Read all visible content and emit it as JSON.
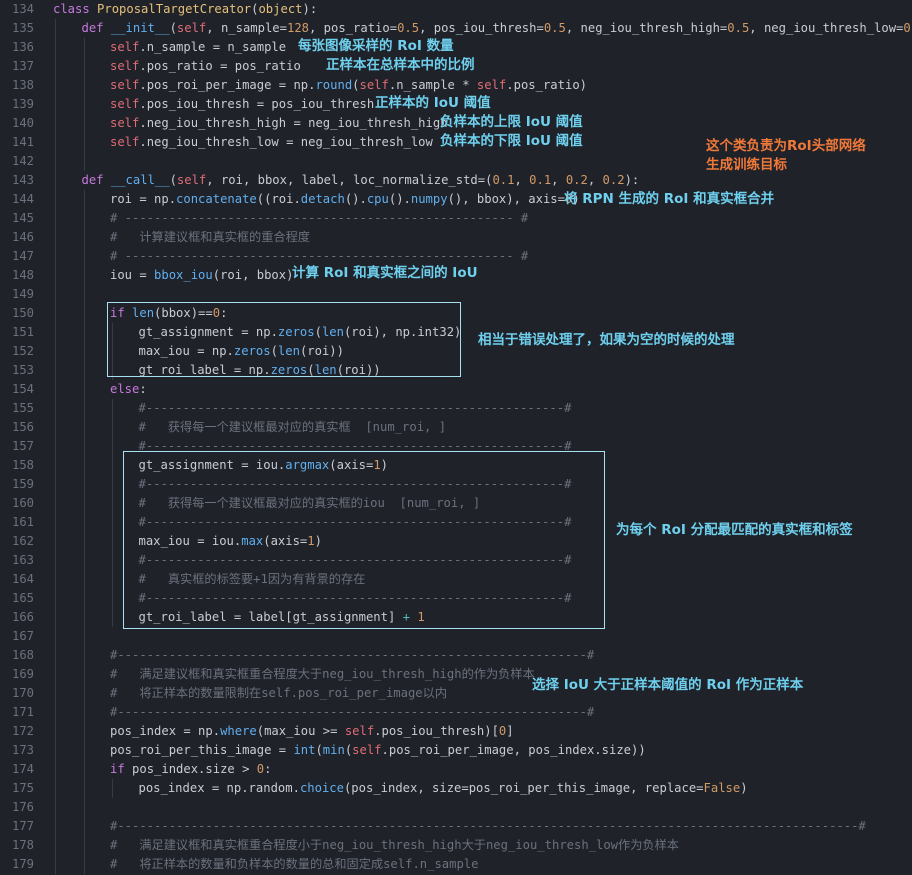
{
  "editor": {
    "lines": [
      {
        "n": "134",
        "indent": 0,
        "tokens": [
          [
            "kw",
            "class "
          ],
          [
            "cls",
            "ProposalTargetCreator"
          ],
          [
            "",
            "("
          ],
          [
            "cls",
            "object"
          ],
          [
            "",
            "):"
          ]
        ]
      },
      {
        "n": "135",
        "indent": 1,
        "tokens": [
          [
            "kw",
            "def "
          ],
          [
            "fn",
            "__init__"
          ],
          [
            "",
            "("
          ],
          [
            "self",
            "self"
          ],
          [
            "",
            ", n_sample="
          ],
          [
            "num",
            "128"
          ],
          [
            "",
            ", pos_ratio="
          ],
          [
            "num",
            "0.5"
          ],
          [
            "",
            ", pos_iou_thresh="
          ],
          [
            "num",
            "0.5"
          ],
          [
            "",
            ", neg_iou_thresh_high="
          ],
          [
            "num",
            "0.5"
          ],
          [
            "",
            ", neg_iou_thresh_low="
          ],
          [
            "num",
            "0"
          ],
          [
            "",
            "):"
          ]
        ]
      },
      {
        "n": "136",
        "indent": 2,
        "tokens": [
          [
            "self",
            "self"
          ],
          [
            "",
            ".n_sample = n_sample"
          ]
        ]
      },
      {
        "n": "137",
        "indent": 2,
        "tokens": [
          [
            "self",
            "self"
          ],
          [
            "",
            ".pos_ratio = pos_ratio"
          ]
        ]
      },
      {
        "n": "138",
        "indent": 2,
        "tokens": [
          [
            "self",
            "self"
          ],
          [
            "",
            ".pos_roi_per_image = np."
          ],
          [
            "fn",
            "round"
          ],
          [
            "",
            "("
          ],
          [
            "self",
            "self"
          ],
          [
            "",
            ".n_sample * "
          ],
          [
            "self",
            "self"
          ],
          [
            "",
            ".pos_ratio)"
          ]
        ]
      },
      {
        "n": "139",
        "indent": 2,
        "tokens": [
          [
            "self",
            "self"
          ],
          [
            "",
            ".pos_iou_thresh = pos_iou_thresh"
          ]
        ]
      },
      {
        "n": "140",
        "indent": 2,
        "tokens": [
          [
            "self",
            "self"
          ],
          [
            "",
            ".neg_iou_thresh_high = neg_iou_thresh_high"
          ]
        ]
      },
      {
        "n": "141",
        "indent": 2,
        "tokens": [
          [
            "self",
            "self"
          ],
          [
            "",
            ".neg_iou_thresh_low = neg_iou_thresh_low"
          ]
        ]
      },
      {
        "n": "142",
        "indent": 2,
        "tokens": []
      },
      {
        "n": "143",
        "indent": 1,
        "tokens": [
          [
            "kw",
            "def "
          ],
          [
            "fn",
            "__call__"
          ],
          [
            "",
            "("
          ],
          [
            "self",
            "self"
          ],
          [
            "",
            ", roi, bbox, label, loc_normalize_std=("
          ],
          [
            "num",
            "0.1"
          ],
          [
            "",
            ", "
          ],
          [
            "num",
            "0.1"
          ],
          [
            "",
            ", "
          ],
          [
            "num",
            "0.2"
          ],
          [
            "",
            ", "
          ],
          [
            "num",
            "0.2"
          ],
          [
            "",
            "):"
          ]
        ]
      },
      {
        "n": "144",
        "indent": 2,
        "tokens": [
          [
            "",
            "roi = np."
          ],
          [
            "fn",
            "concatenate"
          ],
          [
            "",
            "((roi."
          ],
          [
            "fn",
            "detach"
          ],
          [
            "",
            "()."
          ],
          [
            "fn",
            "cpu"
          ],
          [
            "",
            "()."
          ],
          [
            "fn",
            "numpy"
          ],
          [
            "",
            "(), bbox), axis="
          ],
          [
            "num",
            "0"
          ],
          [
            "",
            ")"
          ]
        ]
      },
      {
        "n": "145",
        "indent": 2,
        "tokens": [
          [
            "cm",
            "# ----------------------------------------------------- #"
          ]
        ]
      },
      {
        "n": "146",
        "indent": 2,
        "tokens": [
          [
            "cm",
            "#   计算建议框和真实框的重合程度"
          ]
        ]
      },
      {
        "n": "147",
        "indent": 2,
        "tokens": [
          [
            "cm",
            "# ----------------------------------------------------- #"
          ]
        ]
      },
      {
        "n": "148",
        "indent": 2,
        "tokens": [
          [
            "",
            "iou = "
          ],
          [
            "fn",
            "bbox_iou"
          ],
          [
            "",
            "(roi, bbox)"
          ]
        ]
      },
      {
        "n": "149",
        "indent": 2,
        "tokens": []
      },
      {
        "n": "150",
        "indent": 2,
        "tokens": [
          [
            "kw",
            "if "
          ],
          [
            "fn",
            "len"
          ],
          [
            "",
            "(bbox)=="
          ],
          [
            "num",
            "0"
          ],
          [
            "",
            ":"
          ]
        ]
      },
      {
        "n": "151",
        "indent": 3,
        "tokens": [
          [
            "",
            "gt_assignment = np."
          ],
          [
            "fn",
            "zeros"
          ],
          [
            "",
            "("
          ],
          [
            "fn",
            "len"
          ],
          [
            "",
            "(roi), np.int32)"
          ]
        ]
      },
      {
        "n": "152",
        "indent": 3,
        "tokens": [
          [
            "",
            "max_iou = np."
          ],
          [
            "fn",
            "zeros"
          ],
          [
            "",
            "("
          ],
          [
            "fn",
            "len"
          ],
          [
            "",
            "(roi))"
          ]
        ]
      },
      {
        "n": "153",
        "indent": 3,
        "tokens": [
          [
            "",
            "gt_roi_label = np."
          ],
          [
            "fn",
            "zeros"
          ],
          [
            "",
            "("
          ],
          [
            "fn",
            "len"
          ],
          [
            "",
            "(roi))"
          ]
        ]
      },
      {
        "n": "154",
        "indent": 2,
        "tokens": [
          [
            "kw",
            "else"
          ],
          [
            "",
            ":"
          ]
        ]
      },
      {
        "n": "155",
        "indent": 3,
        "tokens": [
          [
            "cm",
            "#---------------------------------------------------------#"
          ]
        ]
      },
      {
        "n": "156",
        "indent": 3,
        "tokens": [
          [
            "cm",
            "#   获得每一个建议框最对应的真实框  [num_roi, ]"
          ]
        ]
      },
      {
        "n": "157",
        "indent": 3,
        "tokens": [
          [
            "cm",
            "#---------------------------------------------------------#"
          ]
        ]
      },
      {
        "n": "158",
        "indent": 3,
        "tokens": [
          [
            "",
            "gt_assignment = iou."
          ],
          [
            "fn",
            "argmax"
          ],
          [
            "",
            "(axis="
          ],
          [
            "num",
            "1"
          ],
          [
            "",
            ")"
          ]
        ]
      },
      {
        "n": "159",
        "indent": 3,
        "tokens": [
          [
            "cm",
            "#---------------------------------------------------------#"
          ]
        ]
      },
      {
        "n": "160",
        "indent": 3,
        "tokens": [
          [
            "cm",
            "#   获得每一个建议框最对应的真实框的iou  [num_roi, ]"
          ]
        ]
      },
      {
        "n": "161",
        "indent": 3,
        "tokens": [
          [
            "cm",
            "#---------------------------------------------------------#"
          ]
        ]
      },
      {
        "n": "162",
        "indent": 3,
        "tokens": [
          [
            "",
            "max_iou = iou."
          ],
          [
            "fn",
            "max"
          ],
          [
            "",
            "(axis="
          ],
          [
            "num",
            "1"
          ],
          [
            "",
            ")"
          ]
        ]
      },
      {
        "n": "163",
        "indent": 3,
        "tokens": [
          [
            "cm",
            "#---------------------------------------------------------#"
          ]
        ]
      },
      {
        "n": "164",
        "indent": 3,
        "tokens": [
          [
            "cm",
            "#   真实框的标签要+1因为有背景的存在"
          ]
        ]
      },
      {
        "n": "165",
        "indent": 3,
        "tokens": [
          [
            "cm",
            "#---------------------------------------------------------#"
          ]
        ]
      },
      {
        "n": "166",
        "indent": 3,
        "tokens": [
          [
            "",
            "gt_roi_label = label[gt_assignment] "
          ],
          [
            "op",
            "+"
          ],
          [
            "num",
            " 1"
          ]
        ]
      },
      {
        "n": "167",
        "indent": 2,
        "tokens": []
      },
      {
        "n": "168",
        "indent": 2,
        "tokens": [
          [
            "cm",
            "#----------------------------------------------------------------#"
          ]
        ]
      },
      {
        "n": "169",
        "indent": 2,
        "tokens": [
          [
            "cm",
            "#   满足建议框和真实框重合程度大于neg_iou_thresh_high的作为负样本"
          ]
        ]
      },
      {
        "n": "170",
        "indent": 2,
        "tokens": [
          [
            "cm",
            "#   将正样本的数量限制在self.pos_roi_per_image以内"
          ]
        ]
      },
      {
        "n": "171",
        "indent": 2,
        "tokens": [
          [
            "cm",
            "#----------------------------------------------------------------#"
          ]
        ]
      },
      {
        "n": "172",
        "indent": 2,
        "tokens": [
          [
            "",
            "pos_index = np."
          ],
          [
            "fn",
            "where"
          ],
          [
            "",
            "(max_iou >= "
          ],
          [
            "self",
            "self"
          ],
          [
            "",
            ".pos_iou_thresh)["
          ],
          [
            "num",
            "0"
          ],
          [
            "",
            "]"
          ]
        ]
      },
      {
        "n": "173",
        "indent": 2,
        "tokens": [
          [
            "",
            "pos_roi_per_this_image = "
          ],
          [
            "fn",
            "int"
          ],
          [
            "",
            "("
          ],
          [
            "fn",
            "min"
          ],
          [
            "",
            "("
          ],
          [
            "self",
            "self"
          ],
          [
            "",
            ".pos_roi_per_image, pos_index.size))"
          ]
        ]
      },
      {
        "n": "174",
        "indent": 2,
        "tokens": [
          [
            "kw",
            "if "
          ],
          [
            "",
            "pos_index.size > "
          ],
          [
            "num",
            "0"
          ],
          [
            "",
            ":"
          ]
        ]
      },
      {
        "n": "175",
        "indent": 3,
        "tokens": [
          [
            "",
            "pos_index = np.random."
          ],
          [
            "fn",
            "choice"
          ],
          [
            "",
            "(pos_index, size=pos_roi_per_this_image, replace="
          ],
          [
            "num",
            "False"
          ],
          [
            "",
            ")"
          ]
        ]
      },
      {
        "n": "176",
        "indent": 2,
        "tokens": []
      },
      {
        "n": "177",
        "indent": 2,
        "tokens": [
          [
            "cm",
            "#-----------------------------------------------------------------------------------------------------#"
          ]
        ]
      },
      {
        "n": "178",
        "indent": 2,
        "tokens": [
          [
            "cm",
            "#   满足建议框和真实框重合程度小于neg_iou_thresh_high大于neg_iou_thresh_low作为负样本"
          ]
        ]
      },
      {
        "n": "179",
        "indent": 2,
        "tokens": [
          [
            "cm",
            "#   将正样本的数量和负样本的数量的总和固定成self.n_sample"
          ]
        ]
      }
    ]
  },
  "annotations": {
    "n_sample": "每张图像采样的 RoI 数量",
    "pos_ratio": "正样本在总样本中的比例",
    "pos_iou_thresh": "正样本的 IoU 阈值",
    "neg_high": "负样本的上限 IoU 阈值",
    "neg_low": "负样本的下限 IoU 阈值",
    "class_desc_1": "这个类负责为RoI头部网络",
    "class_desc_2": "生成训练目标",
    "concat": "将 RPN 生成的 RoI 和真实框合并",
    "iou_calc": "计算 RoI 和真实框之间的 IoU",
    "empty_case": "相当于错误处理了，如果为空的时候的处理",
    "assign": "为每个 RoI 分配最匹配的真实框和标签",
    "select_pos": "选择 IoU 大于正样本阈值的 RoI 作为正样本"
  },
  "colors": {
    "background": "#1f2229",
    "annotation": "#6fd0ee",
    "annotation_highlight": "#f0793a",
    "box_border": "#a6e1f0"
  }
}
